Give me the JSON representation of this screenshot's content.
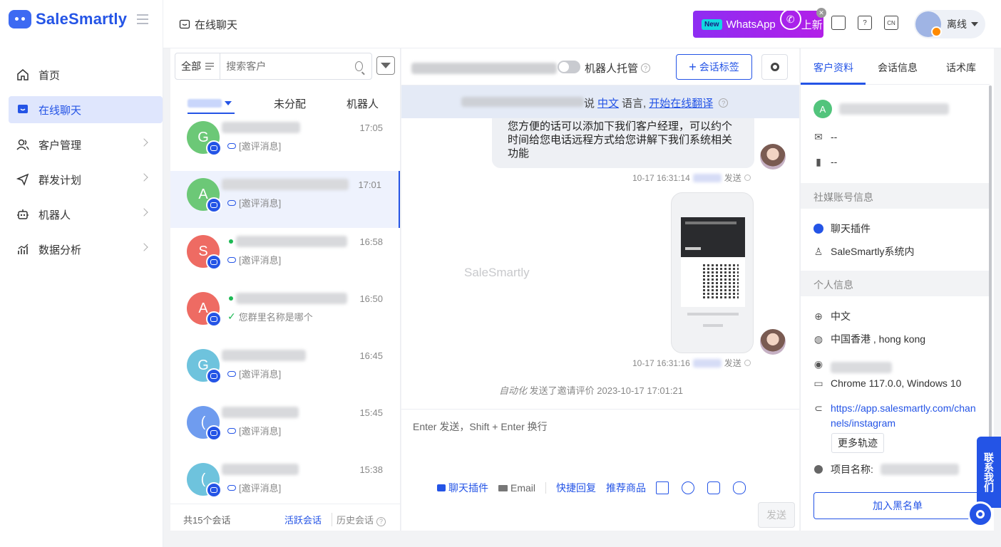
{
  "brand": {
    "name": "SaleSmartly"
  },
  "nav": [
    {
      "label": "首页",
      "icon": "home-icon"
    },
    {
      "label": "在线聊天",
      "icon": "chat-icon",
      "active": true
    },
    {
      "label": "客户管理",
      "icon": "users-icon"
    },
    {
      "label": "群发计划",
      "icon": "send-icon"
    },
    {
      "label": "机器人",
      "icon": "robot-icon"
    },
    {
      "label": "数据分析",
      "icon": "chart-icon"
    }
  ],
  "header": {
    "title": "在线聊天",
    "promo": {
      "badge": "New",
      "text": "WhatsApp",
      "suffix": "上新"
    },
    "lang_badge": "CN",
    "status": "离线"
  },
  "convlist": {
    "filter_label": "全部",
    "search_placeholder": "搜索客户",
    "tabs": [
      "未分配",
      "机器人"
    ],
    "items": [
      {
        "initial": "G",
        "color": "#6cc877",
        "time": "17:05",
        "preview": "[邀评消息]"
      },
      {
        "initial": "A",
        "color": "#6cc877",
        "time": "17:01",
        "preview": "[邀评消息]"
      },
      {
        "initial": "S",
        "color": "#ee6b63",
        "time": "16:58",
        "preview": "[邀评消息]"
      },
      {
        "initial": "A",
        "color": "#ee6b63",
        "time": "16:50",
        "preview": "您群里名称是哪个"
      },
      {
        "initial": "G",
        "color": "#6ec3dd",
        "time": "16:45",
        "preview": "[邀评消息]"
      },
      {
        "initial": "(",
        "color": "#6f9cef",
        "time": "15:45",
        "preview": "[邀评消息]"
      },
      {
        "initial": "(",
        "color": "#6ec3dd",
        "time": "15:38",
        "preview": "[邀评消息]"
      }
    ],
    "footer": {
      "total": "共15个会话",
      "active": "活跃会话",
      "history": "历史会话"
    }
  },
  "chat": {
    "robot_label": "机器人托管",
    "tag_button": "会话标签",
    "translate": {
      "prefix": "说",
      "lang": "中文",
      "mid": "语言,",
      "action": "开始在线翻译"
    },
    "message_text": "您方便的话可以添加下我们客户经理，可以约个时间给您电话远程方式给您讲解下我们系统相关功能",
    "message_time_1": "10-17 16:31:14",
    "message_time_2": "10-17 16:31:16",
    "sent_label": "发送",
    "watermark": "SaleSmartly",
    "auto_note_em": "自动化",
    "auto_note": "发送了邀请评价 2023-10-17 17:01:21",
    "input_placeholder": "Enter 发送，Shift + Enter 换行",
    "tools": {
      "plugin": "聊天插件",
      "email": "Email",
      "quick_reply": "快捷回复",
      "products": "推荐商品"
    },
    "send_button": "发送"
  },
  "profile": {
    "tabs": [
      "客户资料",
      "会话信息",
      "话术库"
    ],
    "avatar_initial": "A",
    "email": "--",
    "phone": "--",
    "social_section": "社媒账号信息",
    "channel": "聊天插件",
    "source": "SaleSmartly系统内",
    "personal_section": "个人信息",
    "language": "中文",
    "location": "中国香港 , hong kong",
    "browser": "Chrome 117.0.0, Windows 10",
    "url": "https://app.salesmartly.com/channels/instagram",
    "more_button": "更多轨迹",
    "project_label": "项目名称:",
    "blacklist_button": "加入黑名单"
  },
  "contact_tab": "联系我们"
}
